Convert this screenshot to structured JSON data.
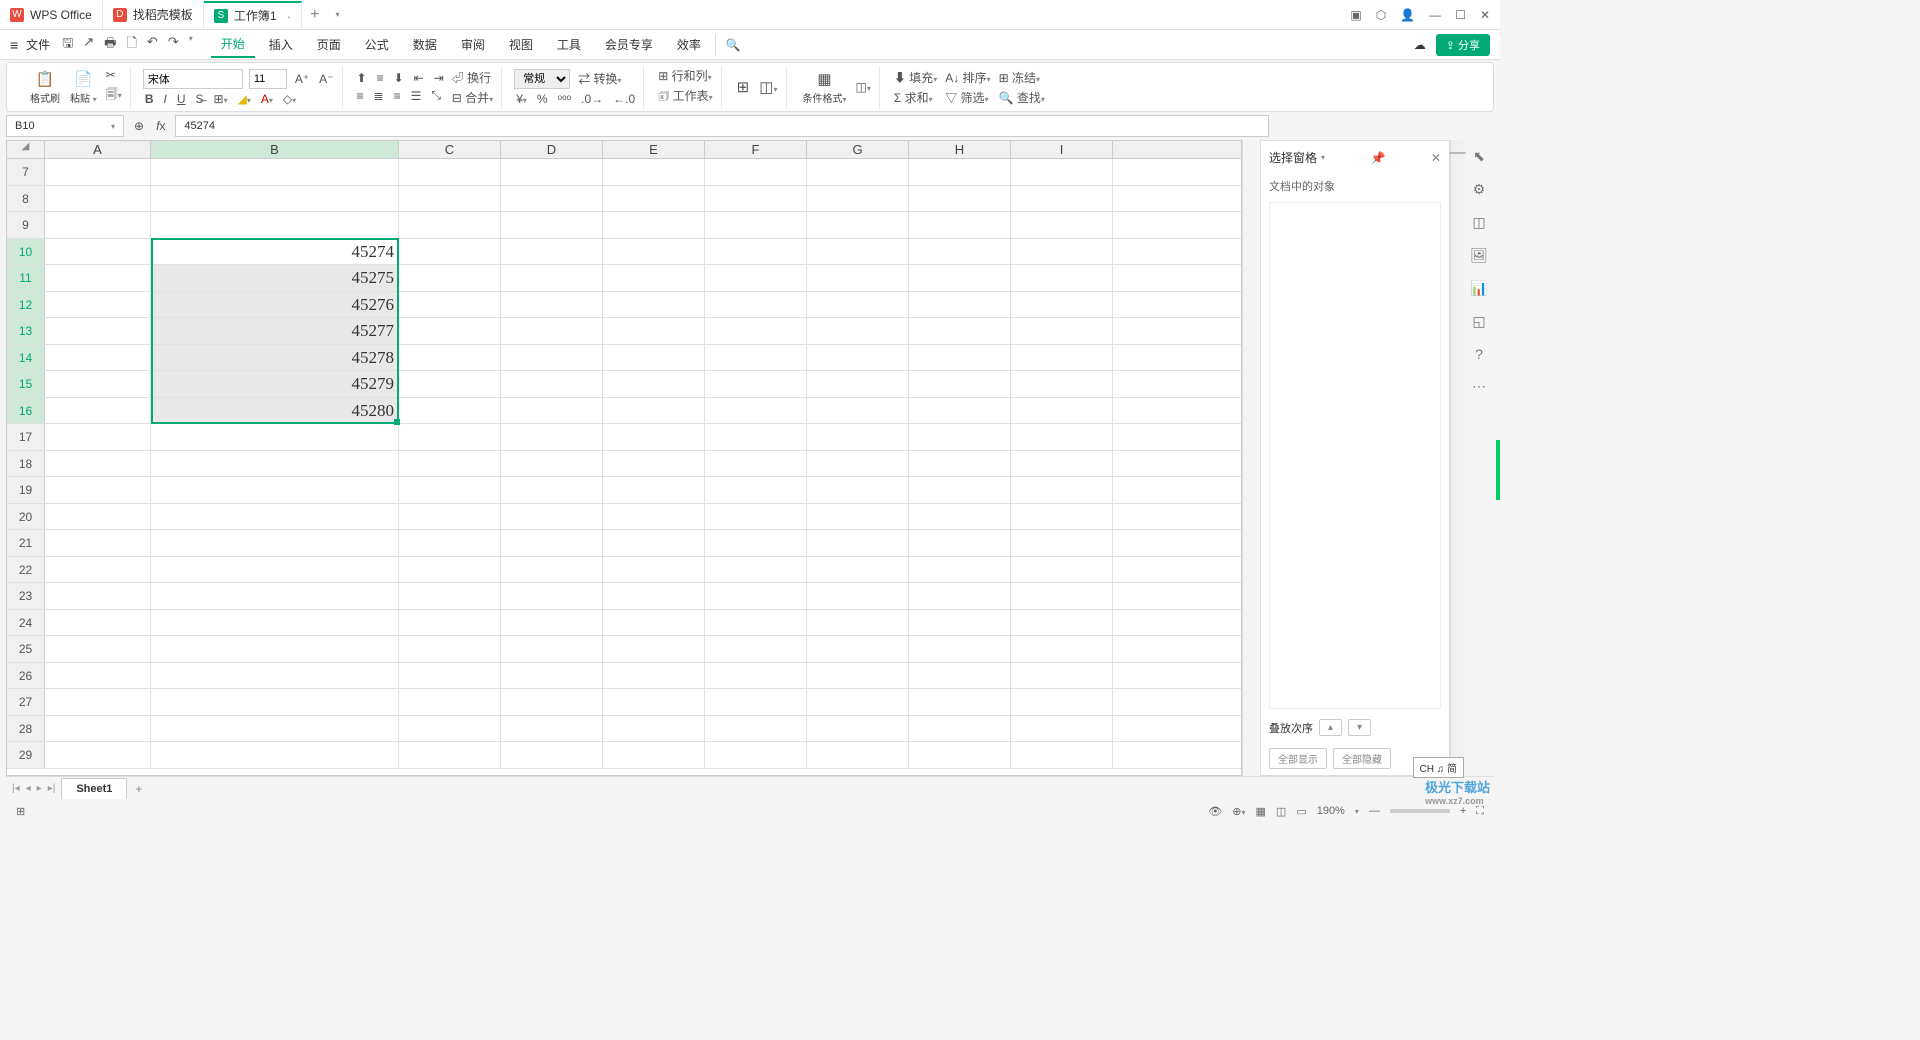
{
  "tabs": {
    "t1": "WPS Office",
    "t2": "找稻壳模板",
    "t3": "工作簿1"
  },
  "menu": {
    "file": "文件",
    "items": [
      "开始",
      "插入",
      "页面",
      "公式",
      "数据",
      "审阅",
      "视图",
      "工具",
      "会员专享",
      "效率"
    ],
    "share": "分享"
  },
  "ribbon": {
    "brush": "格式刷",
    "paste": "粘贴",
    "font": "宋体",
    "size": "11",
    "normal": "常规",
    "convert": "转换",
    "wrap": "换行",
    "merge": "合并",
    "rowcol": "行和列",
    "worksheet": "工作表",
    "condformat": "条件格式",
    "fill": "填充",
    "sort": "排序",
    "freeze": "冻结",
    "sum": "求和",
    "filter": "筛选",
    "find": "查找"
  },
  "namebox": "B10",
  "formula": "45274",
  "cols": [
    "A",
    "B",
    "C",
    "D",
    "E",
    "F",
    "G",
    "H",
    "I"
  ],
  "rows": [
    7,
    8,
    9,
    10,
    11,
    12,
    13,
    14,
    15,
    16,
    17,
    18,
    19,
    20,
    21,
    22,
    23,
    24,
    25,
    26,
    27,
    28,
    29
  ],
  "data": {
    "10": "45274",
    "11": "45275",
    "12": "45276",
    "13": "45277",
    "14": "45278",
    "15": "45279",
    "16": "45280"
  },
  "panel": {
    "title": "选择窗格",
    "sub": "文档中的对象",
    "order": "叠放次序",
    "showall": "全部显示",
    "hideall": "全部隐藏"
  },
  "sheet": "Sheet1",
  "zoom": "190%",
  "ime": "CH ♫ 简",
  "wm": {
    "a": "极光下载站",
    "b": "www.xz7.com"
  }
}
